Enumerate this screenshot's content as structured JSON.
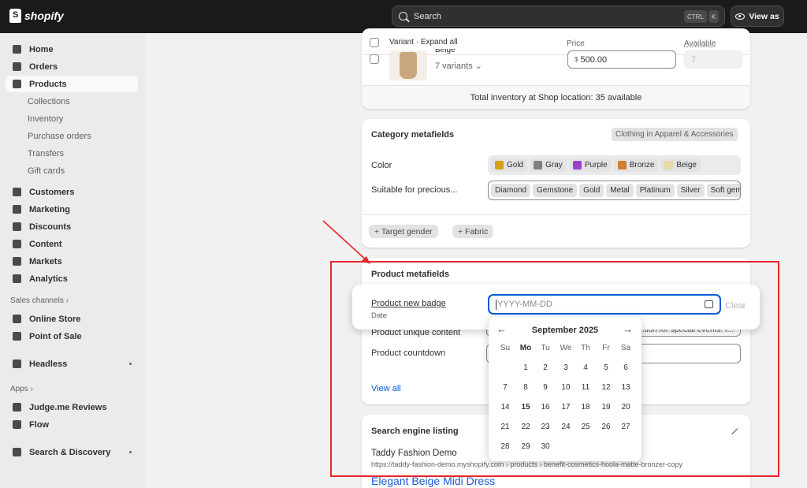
{
  "topbar": {
    "logo": "shopify",
    "search_placeholder": "Search",
    "kbd1": "CTRL",
    "kbd2": "K",
    "view_as": "View as"
  },
  "sidebar": {
    "items": [
      {
        "label": "Home",
        "icon": "home-icon"
      },
      {
        "label": "Orders",
        "icon": "orders-icon"
      },
      {
        "label": "Products",
        "icon": "tag-icon",
        "active": true
      },
      {
        "label": "Collections",
        "sub": true
      },
      {
        "label": "Inventory",
        "sub": true
      },
      {
        "label": "Purchase orders",
        "sub": true
      },
      {
        "label": "Transfers",
        "sub": true
      },
      {
        "label": "Gift cards",
        "sub": true
      },
      {
        "label": "Customers",
        "icon": "person-icon"
      },
      {
        "label": "Marketing",
        "icon": "target-icon"
      },
      {
        "label": "Discounts",
        "icon": "discount-icon"
      },
      {
        "label": "Content",
        "icon": "content-icon"
      },
      {
        "label": "Markets",
        "icon": "globe-icon"
      },
      {
        "label": "Analytics",
        "icon": "chart-icon"
      }
    ],
    "sales_channels_label": "Sales channels",
    "channels": [
      "Online Store",
      "Point of Sale"
    ],
    "headless": "Headless",
    "apps_label": "Apps",
    "apps": [
      "Judge.me Reviews",
      "Flow"
    ],
    "search_discovery": "Search & Discovery"
  },
  "variants": {
    "header_variant": "Variant · Expand all",
    "header_price": "Price",
    "header_available": "Available",
    "name_partial": "Beige",
    "variants_count": "7 variants",
    "currency": "$",
    "price": "500.00",
    "available": "7",
    "total_inventory": "Total inventory at Shop location: 35 available"
  },
  "category": {
    "title": "Category metafields",
    "category_badge": "Clothing in Apparel & Accessories",
    "color_label": "Color",
    "colors": [
      {
        "name": "Gold",
        "hex": "#d4a017"
      },
      {
        "name": "Gray",
        "hex": "#808080"
      },
      {
        "name": "Purple",
        "hex": "#9b40d0"
      },
      {
        "name": "Bronze",
        "hex": "#cd7f32"
      },
      {
        "name": "Beige",
        "hex": "#e8d9a8"
      }
    ],
    "precious_label": "Suitable for precious...",
    "precious": [
      "Diamond",
      "Gemstone",
      "Gold",
      "Metal",
      "Platinum",
      "Silver",
      "Soft gem"
    ],
    "add_target_gender": "+ Target gender",
    "add_fabric": "+ Fabric"
  },
  "product_meta": {
    "title": "Product metafields",
    "badge_label": "Product new badge",
    "badge_type": "Date",
    "date_placeholder": "YYYY-MM-DD",
    "clear": "Clear",
    "unique_content_label": "Product unique content",
    "unique_content_value": "...tion for special events. I...",
    "countdown_label": "Product countdown",
    "view_all": "View all"
  },
  "calendar": {
    "month": "September 2025",
    "weekdays": [
      "Su",
      "Mo",
      "Tu",
      "We",
      "Th",
      "Fr",
      "Sa"
    ],
    "weeks": [
      [
        "",
        "1",
        "2",
        "3",
        "4",
        "5",
        "6"
      ],
      [
        "7",
        "8",
        "9",
        "10",
        "11",
        "12",
        "13"
      ],
      [
        "14",
        "15",
        "16",
        "17",
        "18",
        "19",
        "20"
      ],
      [
        "21",
        "22",
        "23",
        "24",
        "25",
        "26",
        "27"
      ],
      [
        "28",
        "29",
        "30",
        "",
        "",
        "",
        ""
      ]
    ],
    "today": "15"
  },
  "seo": {
    "title": "Search engine listing",
    "store": "Taddy Fashion Demo",
    "url": "https://taddy-fashion-demo.myshopify.com › products › benefit-cosmetics-hoola-matte-bronzer-copy",
    "product_title": "Elegant Beige Midi Dress"
  }
}
